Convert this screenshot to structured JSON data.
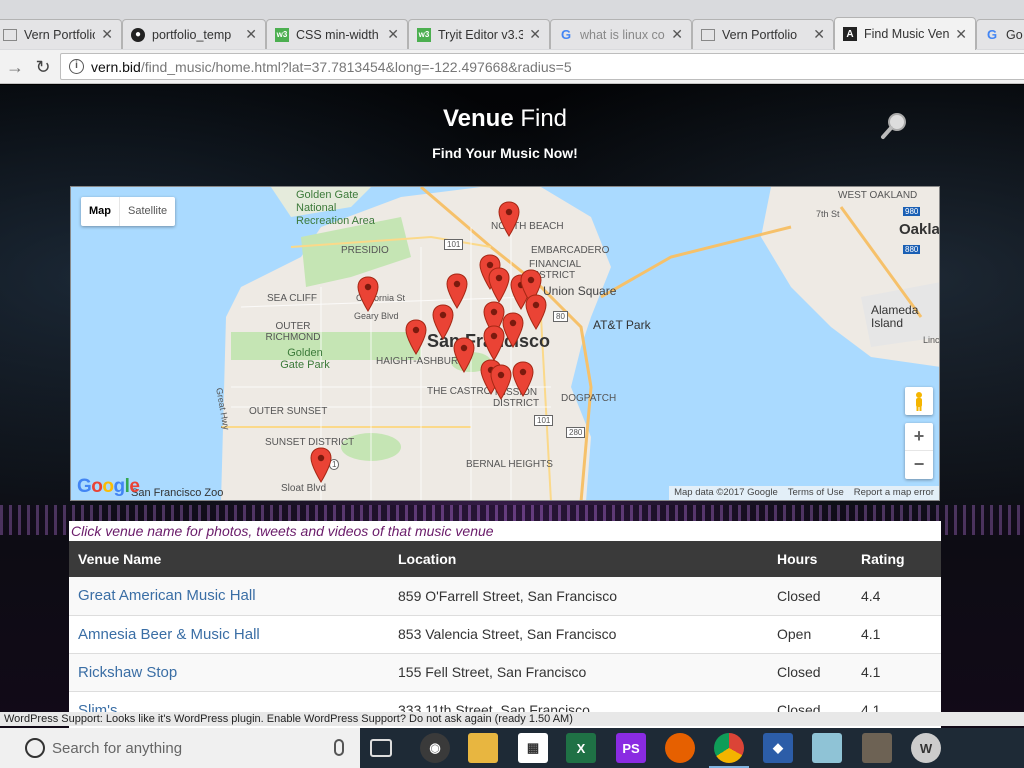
{
  "browser": {
    "tabs": [
      {
        "title": "Vern Portfolio",
        "icon": "page-icon",
        "active": false
      },
      {
        "title": "portfolio_temp",
        "icon": "github-icon",
        "active": false
      },
      {
        "title": "CSS min-width",
        "icon": "w3schools-icon",
        "active": false
      },
      {
        "title": "Tryit Editor v3.3",
        "icon": "w3schools-icon",
        "active": false
      },
      {
        "title": "what is linux co",
        "icon": "google-icon",
        "active": false
      },
      {
        "title": "Vern Portfolio",
        "icon": "page-icon",
        "active": false
      },
      {
        "title": "Find Music Ven",
        "icon": "angular-icon",
        "active": true
      },
      {
        "title": "Go",
        "icon": "google-icon",
        "active": false
      }
    ],
    "url_host": "vern.bid",
    "url_path": "/find_music/home.html?lat=37.7813454&long=-122.497668&radius=5"
  },
  "page": {
    "title_bold": "Venue",
    "title_rest": " Find",
    "subtitle": "Find Your Music Now!"
  },
  "map": {
    "type_map": "Map",
    "type_satellite": "Satellite",
    "city_label": "San Francisco",
    "labels": {
      "golden_gate": "Golden Gate National Recreation Area",
      "presidio": "PRESIDIO",
      "north_beach": "NORTH BEACH",
      "embarcadero": "EMBARCADERO",
      "financial": "FINANCIAL DISTRICT",
      "union_square": "Union Square",
      "att_park": "AT&T Park",
      "sea_cliff": "SEA CLIFF",
      "outer_richmond": "OUTER RICHMOND",
      "golden_gate_park": "Golden Gate Park",
      "haight": "HAIGHT-ASHBURY",
      "castro": "THE CASTRO",
      "mission": "MISSION DISTRICT",
      "dogpatch": "DOGPATCH",
      "outer_sunset": "OUTER SUNSET",
      "sunset": "SUNSET DISTRICT",
      "bernal": "BERNAL HEIGHTS",
      "west_oakland": "WEST OAKLAND",
      "oakland": "Oakla",
      "alameda": "Alameda Island",
      "california_st": "California St",
      "geary": "Geary Blvd",
      "sloat": "Sloat Blvd",
      "zoo": "San Francisco Zoo",
      "great_hwy": "Great Hwy",
      "seventh_st": "7th St",
      "lincoln": "Linco"
    },
    "google": [
      "G",
      "o",
      "o",
      "g",
      "l",
      "e"
    ],
    "footer": [
      "Map data ©2017 Google",
      "Terms of Use",
      "Report a map error"
    ],
    "highway_shields": [
      "101",
      "80",
      "280",
      "101",
      "1",
      "980",
      "880"
    ]
  },
  "table": {
    "hint": "Click venue name for photos, tweets and videos of that music venue",
    "headers": [
      "Venue Name",
      "Location",
      "Hours",
      "Rating"
    ],
    "rows": [
      {
        "name": "Great American Music Hall",
        "location": "859 O'Farrell Street, San Francisco",
        "hours": "Closed",
        "rating": "4.4"
      },
      {
        "name": "Amnesia Beer & Music Hall",
        "location": "853 Valencia Street, San Francisco",
        "hours": "Open",
        "rating": "4.1"
      },
      {
        "name": "Rickshaw Stop",
        "location": "155 Fell Street, San Francisco",
        "hours": "Closed",
        "rating": "4.1"
      },
      {
        "name": "Slim's",
        "location": "333 11th Street, San Francisco",
        "hours": "Closed",
        "rating": "4.1"
      }
    ]
  },
  "notification": "WordPress Support: Looks like it's WordPress plugin. Enable WordPress Support? Do not ask again (ready 1.50 AM)",
  "taskbar": {
    "search_placeholder": "Search for anything",
    "apps": [
      "task-view-icon",
      "media-icon",
      "file-explorer-icon",
      "store-icon",
      "excel-icon",
      "phpstorm-icon",
      "firefox-icon",
      "chrome-icon",
      "sourcetree-icon",
      "notepad-icon",
      "gimp-icon",
      "wordpress-icon"
    ]
  }
}
